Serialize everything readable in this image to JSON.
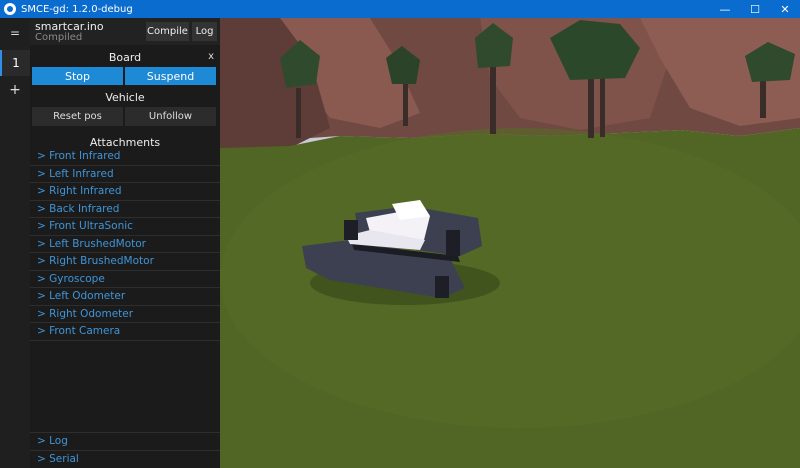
{
  "window": {
    "title": "SMCE-gd: 1.2.0-debug",
    "controls": {
      "minimize": "—",
      "maximize": "☐",
      "close": "✕"
    }
  },
  "sidebar": {
    "menu_icon": "=",
    "tabs": [
      "1"
    ],
    "add_icon": "+"
  },
  "sketch": {
    "name": "smartcar.ino",
    "status": "Compiled",
    "compile_label": "Compile",
    "log_label": "Log"
  },
  "board": {
    "title": "Board",
    "close_label": "x",
    "stop_label": "Stop",
    "suspend_label": "Suspend"
  },
  "vehicle": {
    "title": "Vehicle",
    "reset_label": "Reset pos",
    "unfollow_label": "Unfollow"
  },
  "attachments": {
    "title": "Attachments",
    "items": [
      "> Front Infrared",
      "> Left Infrared",
      "> Right Infrared",
      "> Back Infrared",
      "> Front UltraSonic",
      "> Left BrushedMotor",
      "> Right BrushedMotor",
      "> Gyroscope",
      "> Left Odometer",
      "> Right Odometer",
      "> Front Camera"
    ]
  },
  "bottom": {
    "log_label": "> Log",
    "serial_label": "> Serial"
  },
  "icons": {
    "app": "smce-logo-icon",
    "menu": "hamburger-icon",
    "add": "plus-icon"
  },
  "colors": {
    "titlebar": "#0b6ccf",
    "accent": "#1e8ad6",
    "link": "#3f95d8",
    "grass": "#4f6424",
    "cliff": "#7a4f46"
  }
}
